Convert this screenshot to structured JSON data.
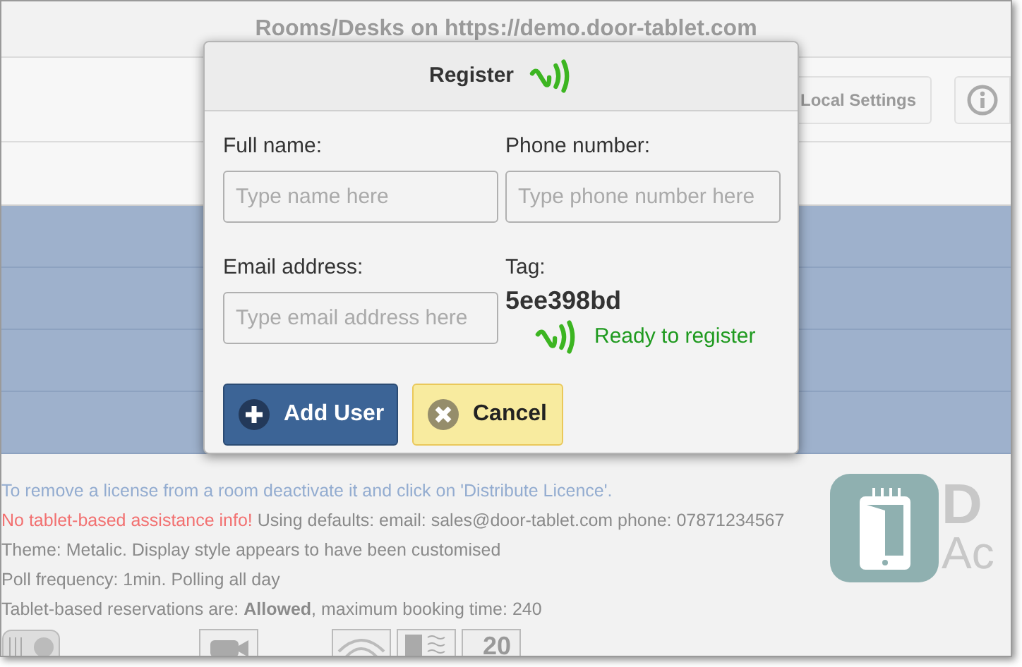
{
  "window": {
    "title": "Rooms/Desks on https://demo.door-tablet.com"
  },
  "toolbar": {
    "buttons": [
      {
        "kind": "text",
        "label": "Local Settings"
      },
      {
        "kind": "info"
      }
    ]
  },
  "info_lines": [
    {
      "kind": "note",
      "text": "To remove a license from a room deactivate it and click on 'Distribute Licence'."
    },
    {
      "kind": "alert",
      "alert": "No tablet-based assistance info!",
      "text": "Using defaults: email: sales@door-tablet.com phone: 07871234567"
    },
    {
      "kind": "plain",
      "text": "Theme: Metalic. Display style appears to have been customised"
    },
    {
      "kind": "plain",
      "text": "Poll frequency: 1min. Polling all day"
    },
    {
      "kind": "plain",
      "text": "Tablet-based reservations are: **Allowed**, maximum booking time: 240"
    }
  ],
  "logo": {
    "text_1": "D",
    "text_2": "Ac"
  },
  "room_icons": [
    {
      "kind": "projector"
    },
    {
      "kind": "camera"
    },
    {
      "kind": "wifi"
    },
    {
      "kind": "display"
    },
    {
      "kind": "capacity",
      "text": "20"
    }
  ],
  "dialog": {
    "title": "Register",
    "fields": [
      {
        "label": "Full name:",
        "placeholder": "Type name here"
      },
      {
        "label": "Phone number:",
        "placeholder": "Type phone number here"
      },
      {
        "label": "Email address:",
        "placeholder": "Type email address here"
      }
    ],
    "tag": {
      "label": "Tag:",
      "value": "5ee398bd",
      "status": "Ready to register"
    },
    "buttons": [
      {
        "kind": "primary",
        "label": "Add User"
      },
      {
        "kind": "cancel",
        "label": "Cancel"
      }
    ]
  }
}
